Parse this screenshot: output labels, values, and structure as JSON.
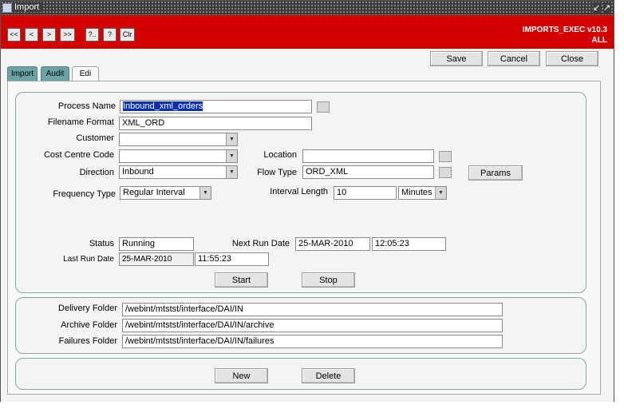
{
  "window": {
    "title": "Import",
    "app_name": "IMPORTS_EXEC v10.3",
    "scope": "ALL"
  },
  "toolbar": {
    "first": "<<",
    "prev": "<",
    "next": ">",
    "last": ">>",
    "query": "?..",
    "help": "?",
    "clear": "Clr"
  },
  "actions": {
    "save": "Save",
    "cancel": "Cancel",
    "close": "Close"
  },
  "tabs": [
    {
      "label": "Import"
    },
    {
      "label": "Audit"
    },
    {
      "label": "Edi",
      "active": true
    }
  ],
  "form": {
    "process_name": {
      "label": "Process Name",
      "value": "Inbound_xml_orders"
    },
    "filename_format": {
      "label": "Filename Format",
      "value": "XML_ORD"
    },
    "customer": {
      "label": "Customer",
      "value": ""
    },
    "cost_centre_code": {
      "label": "Cost Centre Code",
      "value": ""
    },
    "location": {
      "label": "Location",
      "value": ""
    },
    "direction": {
      "label": "Direction",
      "value": "Inbound"
    },
    "flow_type": {
      "label": "Flow Type",
      "value": "ORD_XML"
    },
    "params_button": "Params",
    "frequency_type": {
      "label": "Frequency Type",
      "value": "Regular Interval"
    },
    "interval_length": {
      "label": "Interval Length",
      "value": "10",
      "unit": "Minutes"
    },
    "status": {
      "label": "Status",
      "value": "Running"
    },
    "next_run_date": {
      "label": "Next Run Date",
      "date": "25-MAR-2010",
      "time": "12:05:23"
    },
    "last_run_date": {
      "label": "Last Run Date",
      "date": "25-MAR-2010",
      "time": "11:55:23"
    },
    "start_button": "Start",
    "stop_button": "Stop"
  },
  "folders": {
    "delivery": {
      "label": "Delivery Folder",
      "value": "/webint/mtstst/interface/DAI/IN"
    },
    "archive": {
      "label": "Archive Folder",
      "value": "/webint/mtstst/interface/DAI/IN/archive"
    },
    "failures": {
      "label": "Failures Folder",
      "value": "/webint/mtstst/interface/DAI/IN/failures"
    }
  },
  "bottom": {
    "new_button": "New",
    "delete_button": "Delete"
  },
  "colors": {
    "toolbar_red": "#d20000",
    "tab_teal": "#6aa4a4",
    "selection_blue": "#0a2fb0"
  }
}
